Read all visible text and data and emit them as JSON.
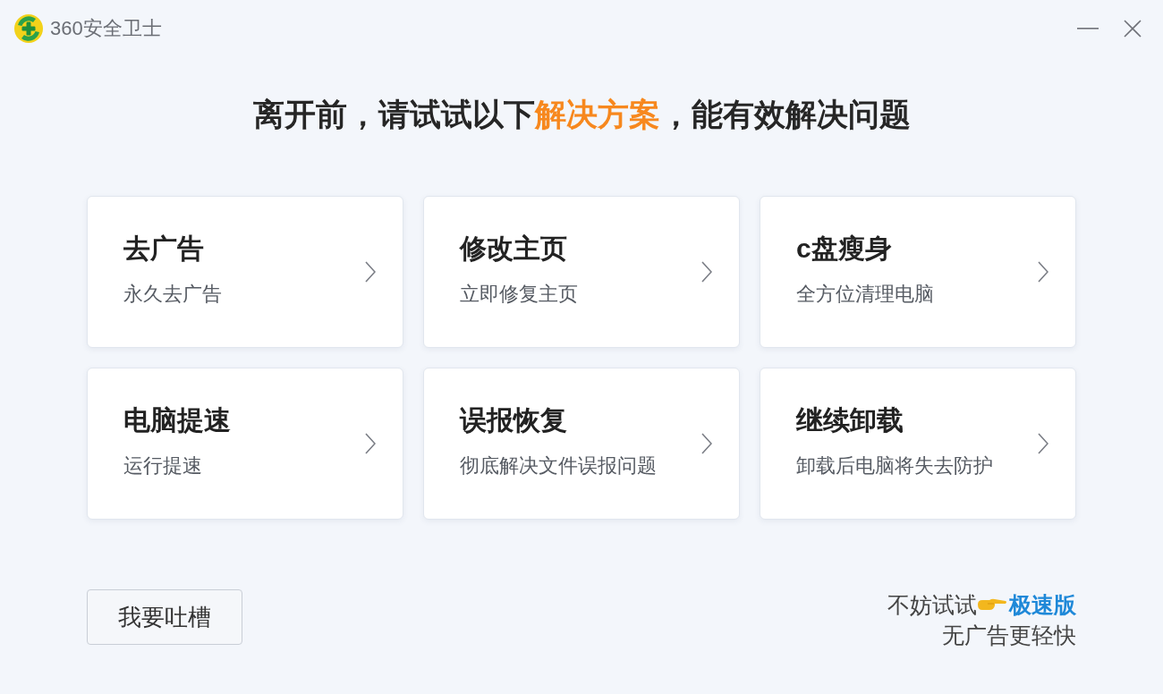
{
  "window": {
    "title": "360安全卫士"
  },
  "headline": [
    {
      "text": "离开前，请试试以下",
      "highlight": false
    },
    {
      "text": "解决方案",
      "highlight": true
    },
    {
      "text": "，能有效解决问题",
      "highlight": false
    }
  ],
  "solutions": [
    {
      "title": "去广告",
      "subtitle": "永久去广告"
    },
    {
      "title": "修改主页",
      "subtitle": "立即修复主页"
    },
    {
      "title": "c盘瘦身",
      "subtitle": "全方位清理电脑"
    },
    {
      "title": "电脑提速",
      "subtitle": "运行提速"
    },
    {
      "title": "误报恢复",
      "subtitle": "彻底解决文件误报问题"
    },
    {
      "title": "继续卸载",
      "subtitle": "卸载后电脑将失去防护"
    }
  ],
  "feedback_button": "我要吐槽",
  "promo": {
    "prompt": "不妨试试",
    "link": "极速版",
    "tagline": "无广告更轻快"
  }
}
